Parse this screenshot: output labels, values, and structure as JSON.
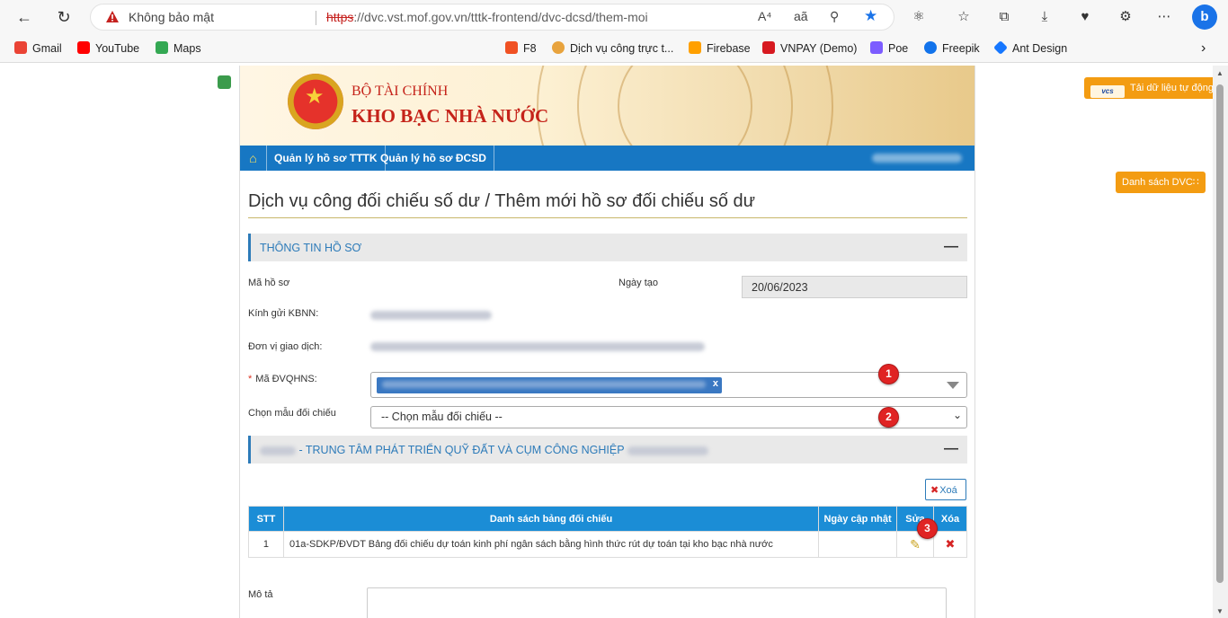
{
  "browser": {
    "security_text": "Không bảo mật",
    "url_protocol": "https",
    "url_rest": "://dvc.vst.mof.gov.vn/tttk-frontend/dvc-dcsd/them-moi",
    "read_aloud_icon": "A⁴",
    "translate_icon": "aã"
  },
  "bookmarks": [
    {
      "label": "Gmail",
      "color": "#ea4335"
    },
    {
      "label": "YouTube",
      "color": "#ff0000"
    },
    {
      "label": "Maps",
      "color": "#34a853"
    },
    {
      "label": "F8",
      "color": "#f05123"
    },
    {
      "label": "Dịch vụ công trực t...",
      "color": "#e8a33d"
    },
    {
      "label": "Firebase",
      "color": "#ffa000"
    },
    {
      "label": "VNPAY (Demo)",
      "color": "#d71920"
    },
    {
      "label": "Poe",
      "color": "#7c5cff"
    },
    {
      "label": "Freepik",
      "color": "#1273eb"
    },
    {
      "label": "Ant Design",
      "color": "#1677ff"
    }
  ],
  "banner": {
    "subtitle": "BỘ TÀI CHÍNH",
    "title": "KHO BẠC NHÀ NƯỚC"
  },
  "menu": {
    "home_icon": "home-icon",
    "items": [
      "Quản lý hồ sơ TTTK",
      "Quản lý hồ sơ ĐCSD"
    ]
  },
  "page": {
    "title": "Dịch vụ công đối chiếu số dư / Thêm mới hồ sơ đối chiếu số dư",
    "section1_title": "THÔNG TIN HỒ SƠ",
    "minimize_symbol": "—",
    "labels": {
      "ma_ho_so": "Mã hồ sơ",
      "ngay_tao": "Ngày tạo",
      "kinh_gui": "Kính gửi KBNN:",
      "don_vi": "Đơn vị giao dịch:",
      "ma_dvqhns": "Mã ĐVQHNS:",
      "chon_mau": "Chọn mẫu đối chiếu"
    },
    "ngay_tao_value": "20/06/2023",
    "required_mark": "*",
    "chip_remove": "x",
    "select_placeholder": "-- Chọn mẫu đối chiếu --",
    "select_caret": "⌄",
    "section2_title": "- TRUNG TÂM PHÁT TRIỂN QUỸ ĐẤT VÀ CỤM CÔNG NGHIỆP",
    "delete_button": "Xoá",
    "delete_icon_text": "✖",
    "mota_label": "Mô tả"
  },
  "badges": [
    "1",
    "2",
    "3"
  ],
  "table": {
    "headers": [
      "STT",
      "Danh sách bảng đối chiếu",
      "Ngày cập nhật",
      "Sửa",
      "Xóa"
    ],
    "rows": [
      {
        "stt": "1",
        "name": "01a-SDKP/ĐVDT Bảng đối chiếu dự toán kinh phí ngân sách bằng hình thức rút dự toán tại kho bạc nhà nước",
        "updated": "",
        "edit_icon": "✎",
        "delete_icon": "✖"
      }
    ]
  },
  "side_buttons": {
    "upload_logo": "vcs",
    "upload": "Tải dữ liệu tự động",
    "list": "Danh sách DVC∷"
  },
  "colors": {
    "primary": "#1777c3",
    "header_table": "#1b8dd6",
    "accent_orange": "#f39c12",
    "banner_red": "#c5231a",
    "badge_red": "#e02424"
  }
}
